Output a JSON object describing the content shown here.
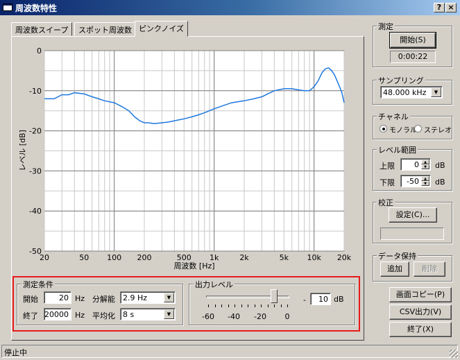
{
  "window": {
    "title": "周波数特性",
    "help_btn": "?",
    "close_btn": "×"
  },
  "tabs": [
    {
      "label": "周波数スイープ",
      "active": false
    },
    {
      "label": "スポット周波数",
      "active": false
    },
    {
      "label": "ピンクノイズ",
      "active": true
    }
  ],
  "chart_data": {
    "type": "line",
    "xlabel": "周波数 [Hz]",
    "ylabel": "レベル [dB]",
    "x_scale": "log",
    "xlim": [
      20,
      20000
    ],
    "ylim": [
      -50,
      0
    ],
    "x_ticks": [
      {
        "v": 20,
        "label": "20"
      },
      {
        "v": 50,
        "label": "50"
      },
      {
        "v": 100,
        "label": "100"
      },
      {
        "v": 200,
        "label": "200"
      },
      {
        "v": 500,
        "label": "500"
      },
      {
        "v": 1000,
        "label": "1k"
      },
      {
        "v": 2000,
        "label": "2k"
      },
      {
        "v": 5000,
        "label": "5k"
      },
      {
        "v": 10000,
        "label": "10k"
      },
      {
        "v": 20000,
        "label": "20k"
      }
    ],
    "y_ticks": [
      0,
      -10,
      -20,
      -30,
      -40,
      -50
    ],
    "grid": true,
    "series": [
      {
        "color": "#1e78e0",
        "x": [
          20,
          25,
          30,
          35,
          40,
          50,
          60,
          70,
          80,
          100,
          120,
          140,
          160,
          180,
          200,
          220,
          250,
          300,
          350,
          400,
          500,
          600,
          700,
          800,
          1000,
          1200,
          1500,
          2000,
          2500,
          3000,
          4000,
          5000,
          6000,
          7000,
          8000,
          9000,
          10000,
          11000,
          12000,
          13000,
          14000,
          15000,
          16000,
          17000,
          18000,
          19000,
          20000
        ],
        "y": [
          -12,
          -12,
          -11,
          -11,
          -10.5,
          -10.8,
          -11.5,
          -12,
          -12.5,
          -13,
          -14,
          -15,
          -16.5,
          -17.5,
          -18,
          -18,
          -18.2,
          -18,
          -17.8,
          -17.5,
          -17,
          -16.5,
          -16,
          -15.5,
          -14.5,
          -13.8,
          -13,
          -12.5,
          -12,
          -11.5,
          -10,
          -9.5,
          -9.5,
          -9.8,
          -10,
          -10,
          -9,
          -7.5,
          -5.5,
          -4.5,
          -4.3,
          -5,
          -6,
          -7.5,
          -9,
          -10.5,
          -13
        ]
      }
    ]
  },
  "measure": {
    "group_label": "測定",
    "start_button": "開始(S)",
    "elapsed": "0:00:22"
  },
  "sampling": {
    "group_label": "サンプリング",
    "value": "48.000 kHz"
  },
  "channel": {
    "group_label": "チャネル",
    "mono": "モノラル",
    "stereo": "ステレオ",
    "selected": "mono"
  },
  "level_range": {
    "group_label": "レベル範囲",
    "upper_label": "上限",
    "upper_value": "0",
    "lower_label": "下限",
    "lower_value": "-50",
    "unit": "dB"
  },
  "calibration": {
    "group_label": "校正",
    "settings_button": "設定(C)...",
    "value": ""
  },
  "data_keep": {
    "group_label": "データ保持",
    "add_button": "追加",
    "delete_button": "削除"
  },
  "conditions": {
    "group_label": "測定条件",
    "start_label": "開始",
    "start_value": "20",
    "start_unit": "Hz",
    "end_label": "終了",
    "end_value": "20000",
    "end_unit": "Hz",
    "resolution_label": "分解能",
    "resolution_value": "2.9 Hz",
    "averaging_label": "平均化",
    "averaging_value": "8 s"
  },
  "output_level": {
    "group_label": "出力レベル",
    "scale_labels": [
      "-60",
      "-40",
      "-20",
      "0"
    ],
    "value": "10",
    "unit": "dB",
    "minus": "-",
    "slider_value_db": -10
  },
  "buttons": {
    "screen_copy": "画面コピー(P)",
    "csv_output": "CSV出力(V)",
    "exit": "終了(X)"
  },
  "status": {
    "text": "停止中"
  },
  "highlight_color": "#e8191b"
}
